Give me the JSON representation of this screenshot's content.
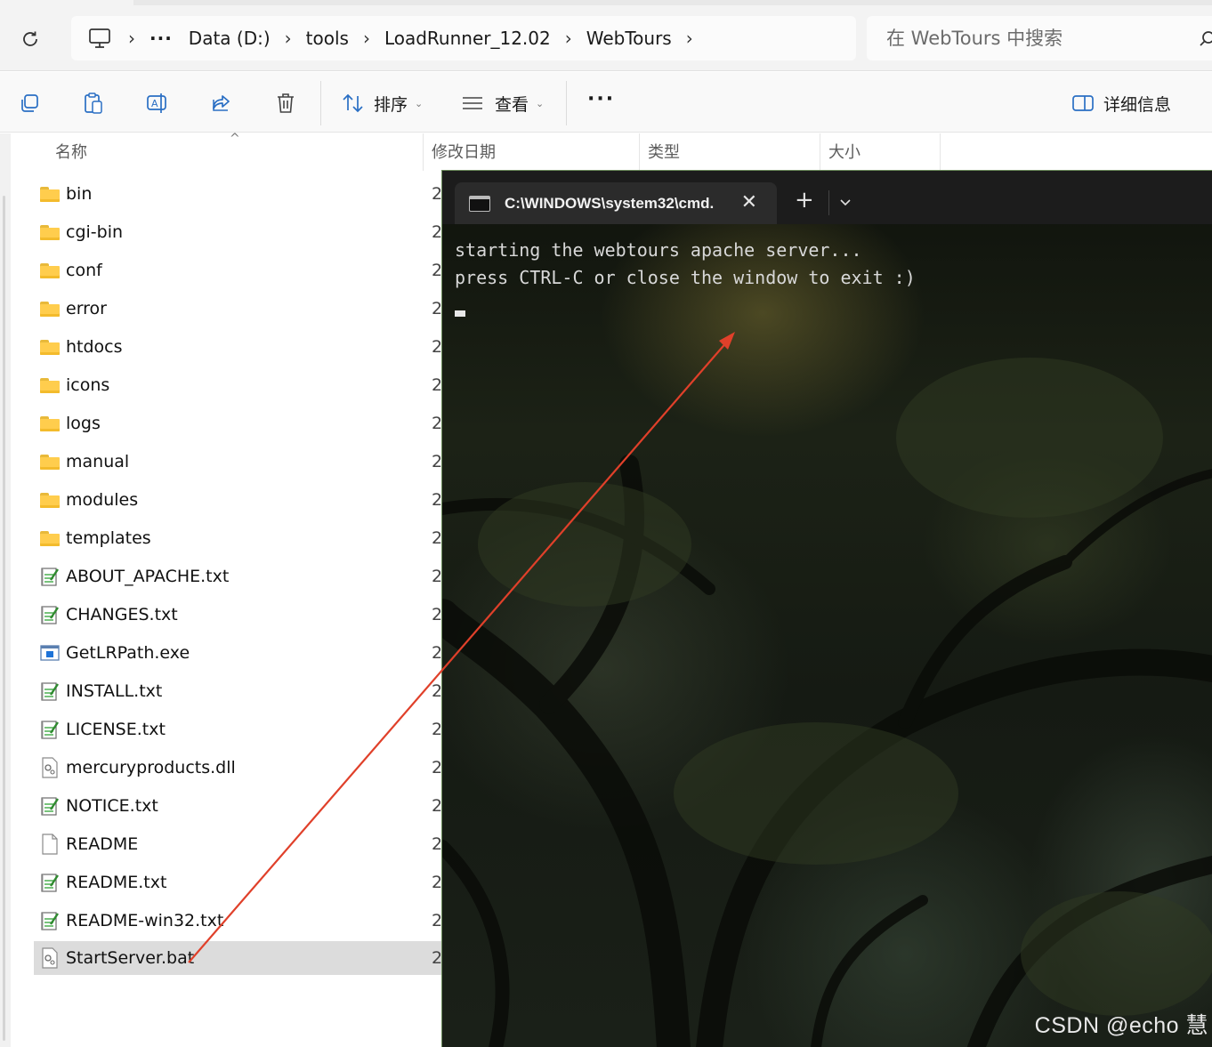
{
  "address_bar": {
    "breadcrumbs": [
      "Data (D:)",
      "tools",
      "LoadRunner_12.02",
      "WebTours"
    ],
    "search_placeholder": "在 WebTours 中搜索"
  },
  "toolbar": {
    "sort_label": "排序",
    "view_label": "查看",
    "details_label": "详细信息"
  },
  "columns": {
    "name": "名称",
    "modified": "修改日期",
    "type": "类型",
    "size": "大小"
  },
  "files": [
    {
      "name": "bin",
      "kind": "folder",
      "date_prefix": "2"
    },
    {
      "name": "cgi-bin",
      "kind": "folder",
      "date_prefix": "2"
    },
    {
      "name": "conf",
      "kind": "folder",
      "date_prefix": "2"
    },
    {
      "name": "error",
      "kind": "folder",
      "date_prefix": "2"
    },
    {
      "name": "htdocs",
      "kind": "folder",
      "date_prefix": "2"
    },
    {
      "name": "icons",
      "kind": "folder",
      "date_prefix": "2"
    },
    {
      "name": "logs",
      "kind": "folder",
      "date_prefix": "2"
    },
    {
      "name": "manual",
      "kind": "folder",
      "date_prefix": "2"
    },
    {
      "name": "modules",
      "kind": "folder",
      "date_prefix": "2"
    },
    {
      "name": "templates",
      "kind": "folder",
      "date_prefix": "2"
    },
    {
      "name": "ABOUT_APACHE.txt",
      "kind": "text",
      "date_prefix": "2"
    },
    {
      "name": "CHANGES.txt",
      "kind": "text",
      "date_prefix": "2"
    },
    {
      "name": "GetLRPath.exe",
      "kind": "exe",
      "date_prefix": "2"
    },
    {
      "name": "INSTALL.txt",
      "kind": "text",
      "date_prefix": "2"
    },
    {
      "name": "LICENSE.txt",
      "kind": "text",
      "date_prefix": "2"
    },
    {
      "name": "mercuryproducts.dll",
      "kind": "dll",
      "date_prefix": "2"
    },
    {
      "name": "NOTICE.txt",
      "kind": "text",
      "date_prefix": "2"
    },
    {
      "name": "README",
      "kind": "blank",
      "date_prefix": "2"
    },
    {
      "name": "README.txt",
      "kind": "text",
      "date_prefix": "2"
    },
    {
      "name": "README-win32.txt",
      "kind": "text",
      "date_prefix": "2"
    },
    {
      "name": "StartServer.bat",
      "kind": "bat",
      "date_prefix": "2",
      "selected": true
    }
  ],
  "terminal": {
    "tab_title": "C:\\WINDOWS\\system32\\cmd.",
    "lines": [
      "starting the webtours apache server...",
      "press CTRL-C or close the window to exit :)"
    ],
    "watermark": "CSDN @echo 慧"
  },
  "colors": {
    "annotation_arrow": "#e0402a",
    "selection": "#dcdcdc",
    "folder": "#ffcd4d"
  }
}
